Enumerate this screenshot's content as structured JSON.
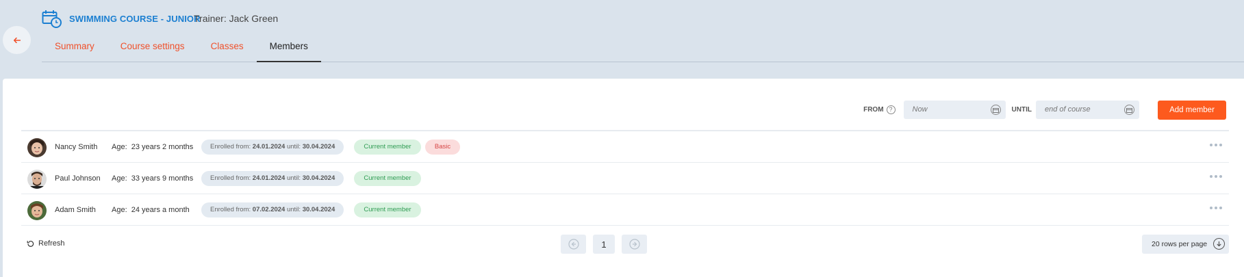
{
  "header": {
    "course_title": "SWIMMING COURSE - JUNIOR",
    "trainer": "Trainer: Jack Green",
    "back_icon": "arrow-left-icon",
    "course_icon": "calendar-clock-icon"
  },
  "tabs": [
    {
      "label": "Summary",
      "active": false
    },
    {
      "label": "Course settings",
      "active": false
    },
    {
      "label": "Classes",
      "active": false
    },
    {
      "label": "Members",
      "active": true
    }
  ],
  "filters": {
    "from_label": "FROM",
    "from_placeholder": "Now",
    "until_label": "UNTIL",
    "until_placeholder": "end of course",
    "add_member_label": "Add member"
  },
  "members": [
    {
      "name": "Nancy Smith",
      "age_label": "Age:",
      "age": "23 years 2 months",
      "enrolled_from_label": "Enrolled from:",
      "enrolled_from": "24.01.2024",
      "until_label": "until:",
      "until": "30.04.2024",
      "status": "Current member",
      "plan": "Basic"
    },
    {
      "name": "Paul Johnson",
      "age_label": "Age:",
      "age": "33 years 9 months",
      "enrolled_from_label": "Enrolled from:",
      "enrolled_from": "24.01.2024",
      "until_label": "until:",
      "until": "30.04.2024",
      "status": "Current member"
    },
    {
      "name": "Adam Smith",
      "age_label": "Age:",
      "age": "24 years a month",
      "enrolled_from_label": "Enrolled from:",
      "enrolled_from": "07.02.2024",
      "until_label": "until:",
      "until": "30.04.2024",
      "status": "Current member"
    }
  ],
  "footer": {
    "refresh_label": "Refresh",
    "current_page": "1",
    "rows_per_page": "20 rows per page"
  },
  "colors": {
    "accent": "#fd5a1e",
    "tab_link": "#f0512b",
    "title_blue": "#1b7fd1",
    "header_bg": "#dae3ec",
    "badge_green_bg": "#d9f2e0",
    "badge_green_text": "#2e9b52",
    "badge_red_bg": "#fbdcdc",
    "badge_red_text": "#d64545"
  }
}
